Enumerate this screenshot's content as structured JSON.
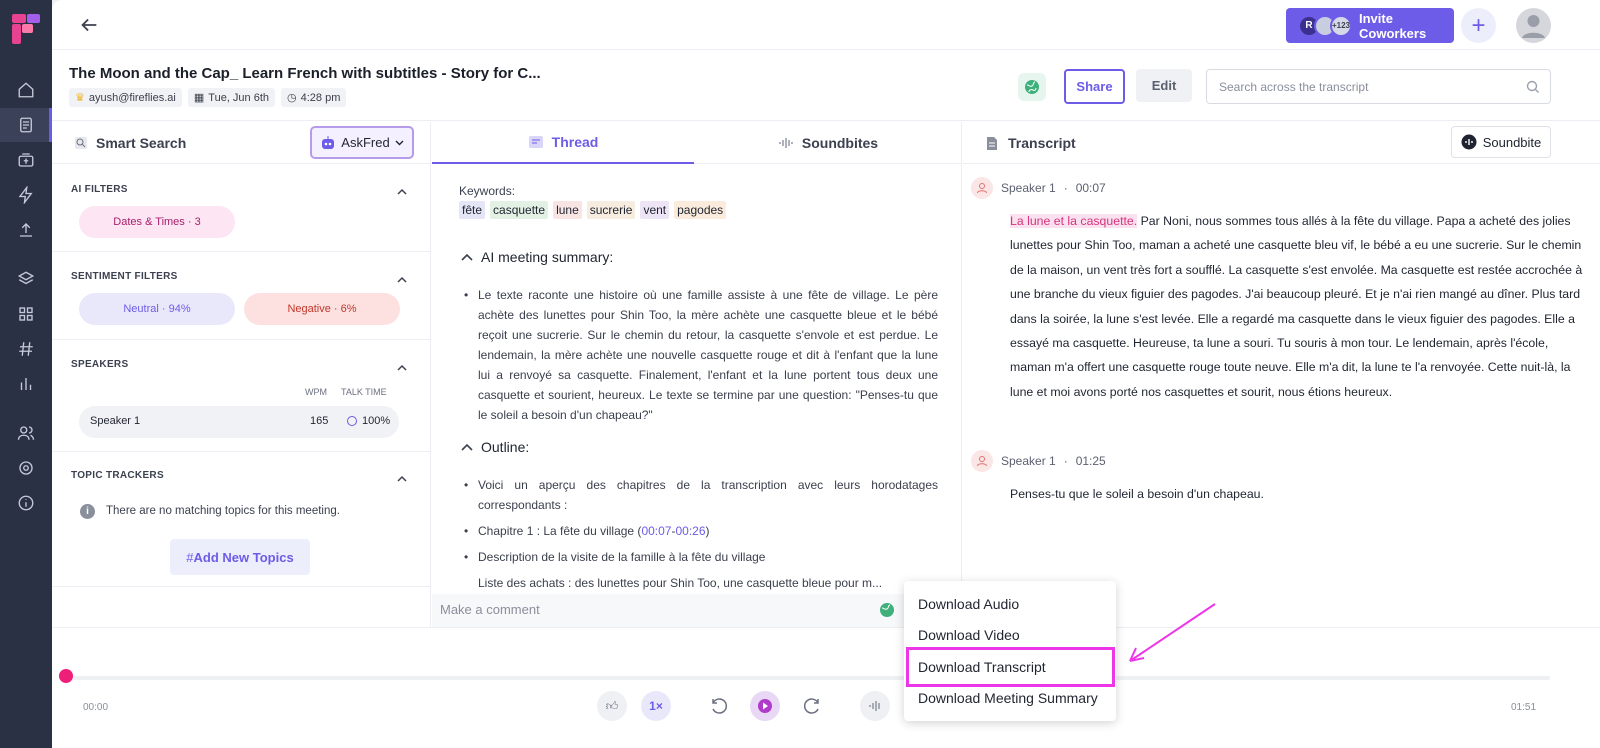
{
  "header": {
    "title": "The Moon and the Cap_ Learn French with subtitles - Story for C...",
    "owner": "ayush@fireflies.ai",
    "date": "Tue, Jun 6th",
    "time": "4:28 pm",
    "share_label": "Share",
    "edit_label": "Edit",
    "search_placeholder": "Search across the transcript",
    "invite_label": "Invite Coworkers",
    "avatar_initial": "R",
    "extra_count": "+123"
  },
  "left": {
    "title": "Smart Search",
    "askfred": "AskFred",
    "ai_filters": {
      "title": "AI FILTERS",
      "pill": "Dates & Times · 3"
    },
    "sentiment": {
      "title": "SENTIMENT FILTERS",
      "neutral": "Neutral · 94%",
      "negative": "Negative · 6%"
    },
    "speakers": {
      "title": "SPEAKERS",
      "col_wpm": "WPM",
      "col_talk": "TALK TIME",
      "rows": [
        {
          "name": "Speaker 1",
          "wpm": "165",
          "talk": "100%"
        }
      ]
    },
    "topics": {
      "title": "TOPIC TRACKERS",
      "empty": "There are no matching topics for this meeting.",
      "add": "Add New Topics"
    }
  },
  "mid": {
    "tabs": [
      "Thread",
      "Soundbites"
    ],
    "keywords_label": "Keywords:",
    "keywords": [
      {
        "text": "fête",
        "bg": "#e4e6f7"
      },
      {
        "text": "casquette",
        "bg": "#e3f1e5"
      },
      {
        "text": "lune",
        "bg": "#f9e4e4"
      },
      {
        "text": "sucrerie",
        "bg": "#f6ece0"
      },
      {
        "text": "vent",
        "bg": "#ede4f6"
      },
      {
        "text": "pagodes",
        "bg": "#fbebdc"
      }
    ],
    "summary_title": "AI meeting summary:",
    "summary": "Le texte raconte une histoire où une famille assiste à une fête de village. Le père achète des lunettes pour Shin Too, la mère achète une casquette bleue et le bébé reçoit une sucrerie. Sur le chemin du retour, la casquette s'envole et est perdue. Le lendemain, la mère achète une nouvelle casquette rouge et dit à l'enfant que la lune lui a renvoyé sa casquette. Finalement, l'enfant et la lune portent tous deux une casquette et sourient, heureux. Le texte se termine par une question: \"Penses-tu que le soleil a besoin d'un chapeau?\"",
    "outline_title": "Outline:",
    "outline": [
      "Voici un aperçu des chapitres de la transcription avec leurs horodatages correspondants :",
      "Chapitre 1 : La fête du village (",
      "Description de la visite de la famille à la fête du village",
      "Liste des achats : des lunettes pour Shin Too, une casquette bleue pour m..."
    ],
    "chapter_start": "00:07",
    "chapter_end": "00:26",
    "comment_placeholder": "Make a comment"
  },
  "right": {
    "title": "Transcript",
    "soundbite": "Soundbite",
    "entries": [
      {
        "speaker": "Speaker 1",
        "time": "00:07",
        "highlight": "La lune et la casquette.",
        "text": " Par Noni, nous sommes tous allés à la fête du village. Papa a acheté des jolies lunettes pour Shin Too, maman a acheté une casquette bleu vif, le bébé a eu une sucrerie. Sur le chemin de la maison, un vent très fort a soufflé. La casquette s'est envolée. Ma casquette est restée accrochée à une branche du vieux figuier des pagodes. J'ai beaucoup pleuré. Et je n'ai rien mangé au dîner. Plus tard dans la soirée, la lune s'est levée. Elle a regardé ma casquette dans le vieux figuier des pagodes. Elle a essayé ma casquette. Heureuse, ta lune a souri. Tu souris à mon tour. Le lendemain, après l'école, maman m'a offert une casquette rouge toute neuve. Elle m'a dit, la lune te l'a renvoyée. Cette nuit-là, la lune et moi avons porté nos casquettes et sourit, nous étions heureux."
      },
      {
        "speaker": "Speaker 1",
        "time": "01:25",
        "highlight": "",
        "text": "Penses-tu que le soleil a besoin d'un chapeau."
      }
    ]
  },
  "player": {
    "start": "00:00",
    "end": "01:51",
    "speed": "1×",
    "progress": 0
  },
  "menu": {
    "items": [
      "Download Audio",
      "Download Video",
      "Download Transcript",
      "Download Meeting Summary"
    ],
    "highlighted_index": 2
  },
  "colors": {
    "accent": "#6c5ce7",
    "highlight": "#ec36e8",
    "knob": "#ee1e79"
  }
}
